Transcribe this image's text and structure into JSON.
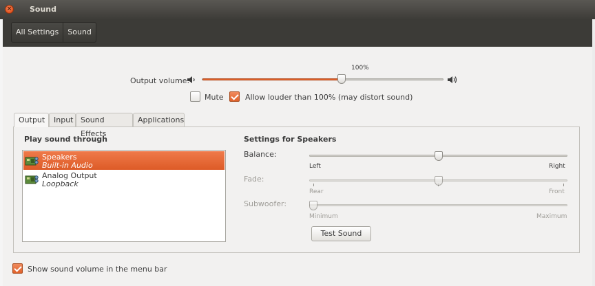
{
  "window": {
    "title": "Sound"
  },
  "toolbar": {
    "breadcrumbs": [
      "All Settings",
      "Sound"
    ]
  },
  "output_volume": {
    "label": "Output volume:",
    "value_percent_label": "100%",
    "level": 0.58,
    "mute_label": "Mute",
    "mute_checked": false,
    "louder_label": "Allow louder than 100% (may distort sound)",
    "louder_checked": true
  },
  "tabs": [
    {
      "label": "Output",
      "active": true
    },
    {
      "label": "Input",
      "active": false
    },
    {
      "label": "Sound Effects",
      "active": false
    },
    {
      "label": "Applications",
      "active": false
    }
  ],
  "output_panel": {
    "play_through_title": "Play sound through",
    "devices": [
      {
        "name": "Speakers",
        "sub": "Built-in Audio",
        "selected": true
      },
      {
        "name": "Analog Output",
        "sub": "Loopback",
        "selected": false
      }
    ],
    "settings_title": "Settings for Speakers",
    "balance": {
      "label": "Balance:",
      "left": "Left",
      "right": "Right",
      "value": 0.5
    },
    "fade": {
      "label": "Fade:",
      "left": "Rear",
      "right": "Front",
      "value": 0.5
    },
    "subwoofer": {
      "label": "Subwoofer:",
      "left": "Minimum",
      "right": "Maximum",
      "value": 0.0
    },
    "test_button": "Test Sound"
  },
  "footer": {
    "show_volume_label": "Show sound volume in the menu bar",
    "show_volume_checked": true
  },
  "colors": {
    "accent": "#e0612a",
    "titlebar": "#3c3b37"
  },
  "icons": {
    "speaker_low": "speaker-low-icon",
    "speaker_high": "speaker-high-icon",
    "device": "sound-card-icon"
  }
}
